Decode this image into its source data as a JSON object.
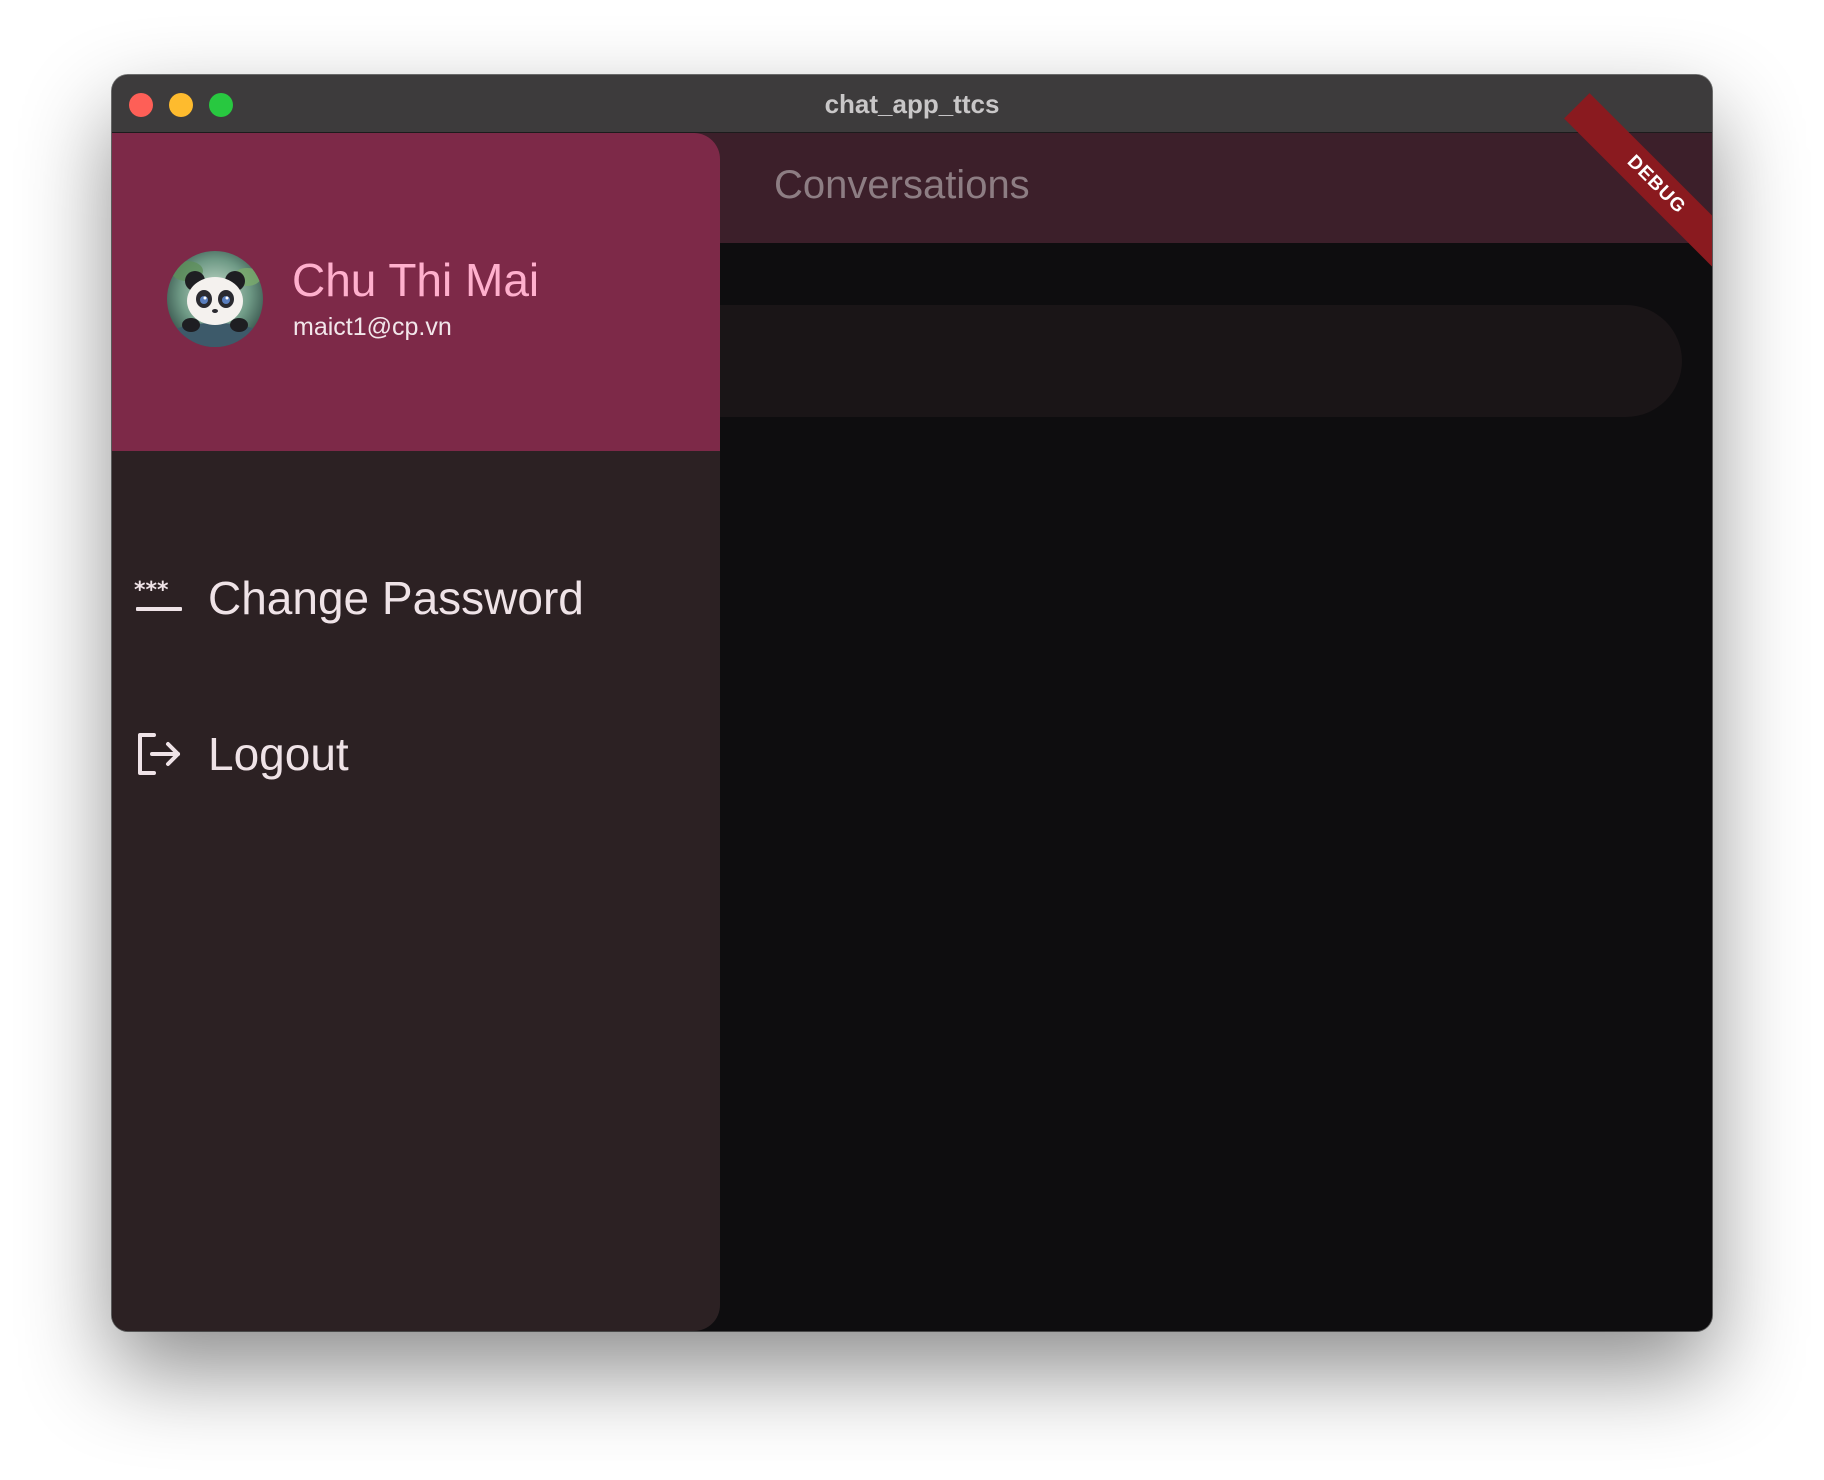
{
  "window": {
    "title": "chat_app_ttcs"
  },
  "appbar": {
    "title": "Conversations"
  },
  "debug_banner": {
    "label": "DEBUG"
  },
  "drawer": {
    "user": {
      "name": "Chu Thi Mai",
      "email": "maict1@cp.vn",
      "avatar_icon": "panda-avatar"
    },
    "items": [
      {
        "label": "Change Password",
        "icon": "password-icon"
      },
      {
        "label": "Logout",
        "icon": "logout-icon"
      }
    ]
  },
  "colors": {
    "drawer_header": "#7d2948",
    "drawer_body": "#2c2123",
    "appbar": "#3c1f2a",
    "accent_name": "#ffb0cd",
    "background": "#0e0d0f"
  }
}
